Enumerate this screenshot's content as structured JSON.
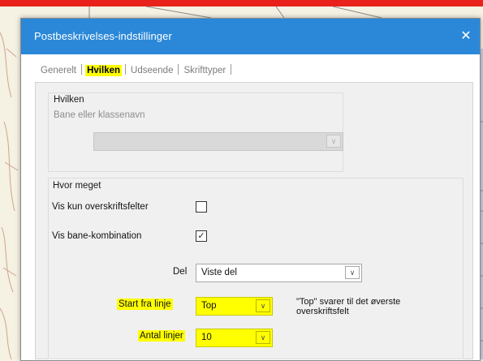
{
  "dialog": {
    "title": "Postbeskrivelses-indstillinger",
    "close_glyph": "✕"
  },
  "tabs": [
    {
      "label": "Generelt",
      "active": false
    },
    {
      "label": "Hvilken",
      "active": true
    },
    {
      "label": "Udseende",
      "active": false
    },
    {
      "label": "Skrifttyper",
      "active": false
    }
  ],
  "which_group": {
    "title": "Hvilken",
    "course_label": "Bane eller klassenavn",
    "course_value": ""
  },
  "amount_group": {
    "title": "Hvor meget",
    "only_headers_label": "Vis kun overskriftsfelter",
    "only_headers_checked": false,
    "show_combination_label": "Vis bane-kombination",
    "show_combination_checked": true,
    "part_label": "Del",
    "part_value": "Viste del",
    "start_line_label": "Start fra linje",
    "start_line_value": "Top",
    "start_line_note": "\"Top\" svarer til det øverste overskriftsfelt",
    "num_lines_label": "Antal linjer",
    "num_lines_value": "10"
  },
  "colors": {
    "titlebar": "#2b88d8",
    "highlight": "#ffff00",
    "map_red": "#e8221b"
  }
}
